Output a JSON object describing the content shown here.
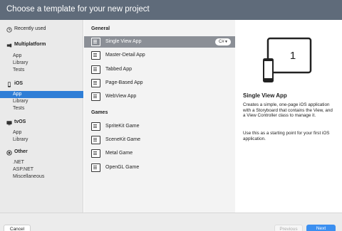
{
  "window": {
    "title": "Choose a template for your new project"
  },
  "sidebar": {
    "recently_used": "Recently used",
    "groups": [
      {
        "title": "Multiplatform",
        "icon": "multiplatform-icon",
        "items": [
          "App",
          "Library",
          "Tests"
        ]
      },
      {
        "title": "iOS",
        "icon": "ios-icon",
        "items": [
          "App",
          "Library",
          "Tests"
        ],
        "selected_item": "App"
      },
      {
        "title": "tvOS",
        "icon": "tvos-icon",
        "items": [
          "App",
          "Library"
        ]
      },
      {
        "title": "Other",
        "icon": "other-icon",
        "items": [
          ".NET",
          "ASP.NET",
          "Miscellaneous"
        ]
      }
    ]
  },
  "templates": {
    "sections": [
      {
        "title": "General",
        "items": [
          "Single View App",
          "Master-Detail App",
          "Tabbed App",
          "Page-Based App",
          "WebView App"
        ]
      },
      {
        "title": "Games",
        "items": [
          "SpriteKit Game",
          "SceneKit Game",
          "Metal Game",
          "OpenGL Game"
        ]
      }
    ],
    "selected": "Single View App",
    "language_selector": "C#"
  },
  "detail": {
    "preview_number": "1",
    "title": "Single View App",
    "description": "Creates a simple, one-page iOS application with a Storyboard that contains the View, and a View Controller class to manage it.",
    "hint": "Use this as a starting point for your first iOS application."
  },
  "footer": {
    "cancel_label": "Cancel",
    "previous_label": "Previous",
    "next_label": "Next"
  },
  "colors": {
    "header": "#5f6b7a",
    "selection_blue": "#2f7ed6",
    "selected_template": "#8b8f96",
    "primary_button": "#3b8ff0"
  }
}
